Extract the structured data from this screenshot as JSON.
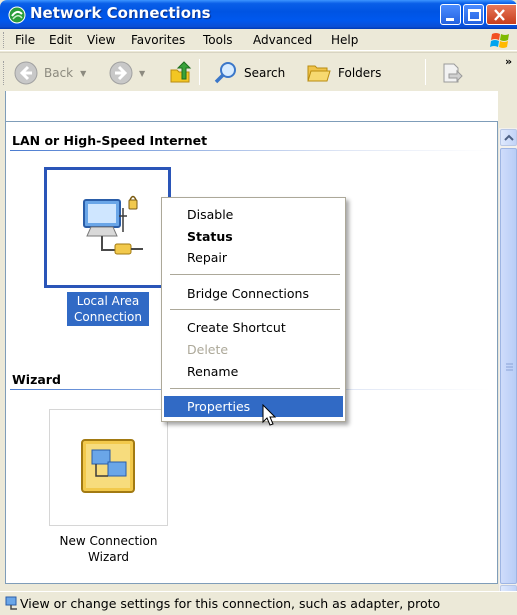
{
  "window": {
    "title": "Network Connections"
  },
  "menu": {
    "items": [
      "File",
      "Edit",
      "View",
      "Favorites",
      "Tools",
      "Advanced",
      "Help"
    ]
  },
  "toolbar": {
    "back_label": "Back",
    "search_label": "Search",
    "folders_label": "Folders",
    "more_label": "»"
  },
  "groups": {
    "lan": {
      "header": "LAN or High-Speed Internet",
      "item_label_1": "Local Area",
      "item_label_2": "Connection"
    },
    "wizard": {
      "header": "Wizard",
      "item_label_1": "New Connection",
      "item_label_2": "Wizard"
    }
  },
  "context_menu": {
    "items": [
      {
        "label": "Disable",
        "bold": false,
        "disabled": false
      },
      {
        "label": "Status",
        "bold": true,
        "disabled": false
      },
      {
        "label": "Repair",
        "bold": false,
        "disabled": false
      },
      {
        "label": "Bridge Connections",
        "bold": false,
        "disabled": false
      },
      {
        "label": "Create Shortcut",
        "bold": false,
        "disabled": false
      },
      {
        "label": "Delete",
        "bold": false,
        "disabled": true
      },
      {
        "label": "Rename",
        "bold": false,
        "disabled": false
      },
      {
        "label": "Properties",
        "bold": false,
        "disabled": false,
        "highlighted": true
      }
    ]
  },
  "statusbar": {
    "text": "View or change settings for this connection, such as adapter, proto"
  },
  "colors": {
    "selection": "#316ac5",
    "title_blue": "#0054e3",
    "face": "#ece9d8"
  }
}
